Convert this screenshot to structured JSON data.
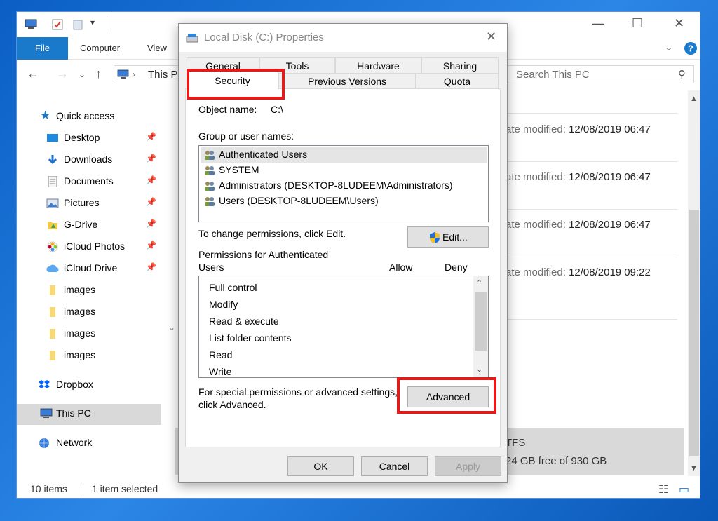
{
  "explorer": {
    "ribbon_tabs": [
      "File",
      "Computer",
      "View"
    ],
    "address": "This PC",
    "search_placeholder": "Search This PC",
    "nav": {
      "items": [
        {
          "label": "Quick access",
          "pinned": false
        },
        {
          "label": "Desktop",
          "pinned": true
        },
        {
          "label": "Downloads",
          "pinned": true
        },
        {
          "label": "Documents",
          "pinned": true
        },
        {
          "label": "Pictures",
          "pinned": true
        },
        {
          "label": "G-Drive",
          "pinned": true
        },
        {
          "label": "iCloud Photos",
          "pinned": true
        },
        {
          "label": "iCloud Drive",
          "pinned": true
        },
        {
          "label": "images",
          "pinned": false
        },
        {
          "label": "images",
          "pinned": false
        },
        {
          "label": "images",
          "pinned": false
        },
        {
          "label": "images",
          "pinned": false
        },
        {
          "label": "Dropbox",
          "pinned": false
        },
        {
          "label": "This PC",
          "pinned": false,
          "selected": true
        },
        {
          "label": "Network",
          "pinned": false
        }
      ]
    },
    "content": {
      "rows": [
        {
          "label": "ate modified:",
          "value": "12/08/2019 06:47"
        },
        {
          "label": "ate modified:",
          "value": "12/08/2019 06:47"
        },
        {
          "label": "ate modified:",
          "value": "12/08/2019 06:47"
        },
        {
          "label": "ate modified:",
          "value": "12/08/2019 09:22"
        }
      ],
      "drive_fs": "TFS",
      "drive_free": "24 GB free of 930 GB"
    },
    "status": {
      "items": "10 items",
      "selected": "1 item selected"
    }
  },
  "dialog": {
    "title": "Local Disk (C:) Properties",
    "tabs_row1": [
      "General",
      "Tools",
      "Hardware",
      "Sharing"
    ],
    "tabs_row2": [
      "Security",
      "Previous Versions",
      "Quota"
    ],
    "active_tab": "Security",
    "object_name_label": "Object name:",
    "object_name_value": "C:\\",
    "group_label": "Group or user names:",
    "users": [
      {
        "name": "Authenticated Users",
        "selected": true
      },
      {
        "name": "SYSTEM",
        "selected": false
      },
      {
        "name": "Administrators (DESKTOP-8LUDEEM\\Administrators)",
        "selected": false
      },
      {
        "name": "Users (DESKTOP-8LUDEEM\\Users)",
        "selected": false
      }
    ],
    "change_text": "To change permissions, click Edit.",
    "edit_button": "Edit...",
    "perm_label_line1": "Permissions for Authenticated",
    "perm_label_line2": "Users",
    "allow_label": "Allow",
    "deny_label": "Deny",
    "permissions": [
      "Full control",
      "Modify",
      "Read & execute",
      "List folder contents",
      "Read",
      "Write"
    ],
    "special_line1": "For special permissions or advanced settings,",
    "special_line2": "click Advanced.",
    "advanced_button": "Advanced",
    "ok_button": "OK",
    "cancel_button": "Cancel",
    "apply_button": "Apply"
  },
  "colors": {
    "desktop": "#1a6fd0",
    "file_tab": "#1979ca",
    "highlight": "#e31b1b",
    "selection": "#d9d9d9"
  }
}
